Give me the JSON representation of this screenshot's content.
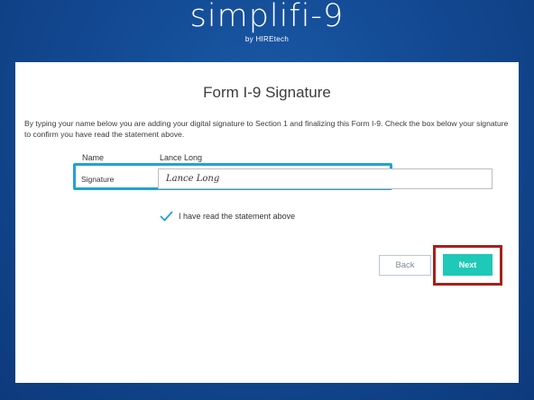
{
  "brand": {
    "logo_text": "simplifi-9",
    "byline": "by HIREtech"
  },
  "form": {
    "title": "Form I-9 Signature",
    "intro": "By typing your name below you are adding your digital signature to Section 1 and finalizing this Form I-9. Check the box below your signature to confirm you have read the statement above.",
    "name_label": "Name",
    "name_value": "Lance Long",
    "signature_label": "Signature",
    "signature_value": "Lance Long",
    "checkbox_label": "I have read the statement above",
    "checkbox_checked": true
  },
  "buttons": {
    "back": "Back",
    "next": "Next"
  },
  "colors": {
    "accent": "#1ec9b7",
    "focus_outline": "#1fa3d6",
    "annotation": "#a8201a",
    "background": "#134a93"
  },
  "icons": {
    "checkbox": "check-icon"
  }
}
